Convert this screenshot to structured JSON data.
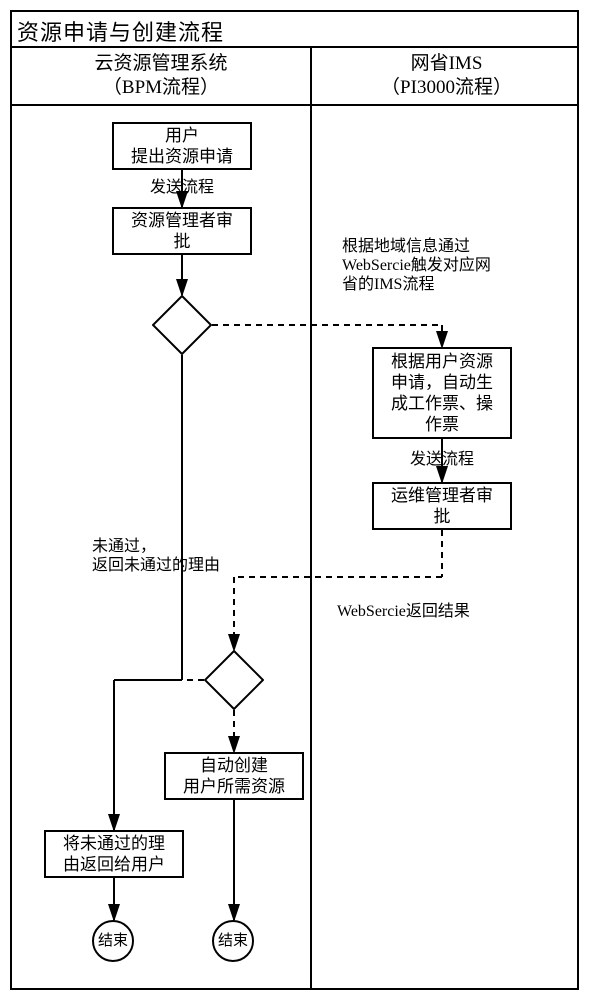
{
  "title": "资源申请与创建流程",
  "left_col": {
    "h1": "云资源管理系统",
    "h2": "（BPM流程）"
  },
  "right_col": {
    "h1": "网省IMS",
    "h2": "（PI3000流程）"
  },
  "nodes": {
    "n1": {
      "l1": "用户",
      "l2": "提出资源申请"
    },
    "n2": {
      "l1": "资源管理者审",
      "l2": "批"
    },
    "n3": {
      "l1": "根据用户资源",
      "l2": "申请，自动生",
      "l3": "成工作票、操",
      "l4": "作票"
    },
    "n4": {
      "l1": "运维管理者审",
      "l2": "批"
    },
    "n5": {
      "l1": "自动创建",
      "l2": "用户所需资源"
    },
    "n6": {
      "l1": "将未通过的理",
      "l2": "由返回给用户"
    },
    "end": "结束"
  },
  "labels": {
    "send1": "发送流程",
    "trig1": "根据地域信息通过",
    "trig2": "WebSercie触发对应网",
    "trig3": "省的IMS流程",
    "send2": "发送流程",
    "ret1": "WebSercie返回结果",
    "fail1": "未通过，",
    "fail2": "返回未通过的理由"
  }
}
